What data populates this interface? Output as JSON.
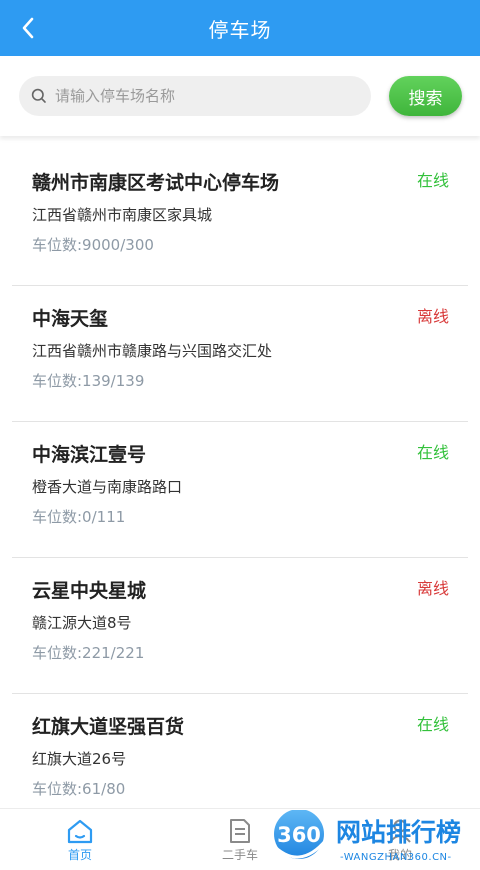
{
  "header": {
    "title": "停车场",
    "back_icon": "back-arrow-icon"
  },
  "search": {
    "placeholder": "请输入停车场名称",
    "value": "",
    "button_label": "搜索"
  },
  "colors": {
    "header_bg": "#2e9bf2",
    "online": "#33c13b",
    "offline": "#d83a3a",
    "search_button": "#48bc44",
    "nav_active": "#2e9bf2",
    "nav_inactive": "#8a8a8a"
  },
  "parking_lots": [
    {
      "name": "赣州市南康区考试中心停车场",
      "status": "在线",
      "online": true,
      "address": "江西省赣州市南康区家具城",
      "capacity": "车位数:9000/300"
    },
    {
      "name": "中海天玺",
      "status": "离线",
      "online": false,
      "address": "江西省赣州市赣康路与兴国路交汇处",
      "capacity": "车位数:139/139"
    },
    {
      "name": "中海滨江壹号",
      "status": "在线",
      "online": true,
      "address": "橙香大道与南康路路口",
      "capacity": "车位数:0/111"
    },
    {
      "name": "云星中央星城",
      "status": "离线",
      "online": false,
      "address": "赣江源大道8号",
      "capacity": "车位数:221/221"
    },
    {
      "name": "红旗大道坚强百货",
      "status": "在线",
      "online": true,
      "address": "红旗大道26号",
      "capacity": "车位数:61/80"
    }
  ],
  "bottom_nav": [
    {
      "label": "首页",
      "icon": "home-icon",
      "active": true
    },
    {
      "label": "二手车",
      "icon": "document-icon",
      "active": false
    },
    {
      "label": "我的",
      "icon": "user-icon",
      "active": false
    }
  ],
  "watermark": {
    "logo_text": "360",
    "site_name": "网站排行榜",
    "url": "-WANGZHAN360.CN-"
  }
}
